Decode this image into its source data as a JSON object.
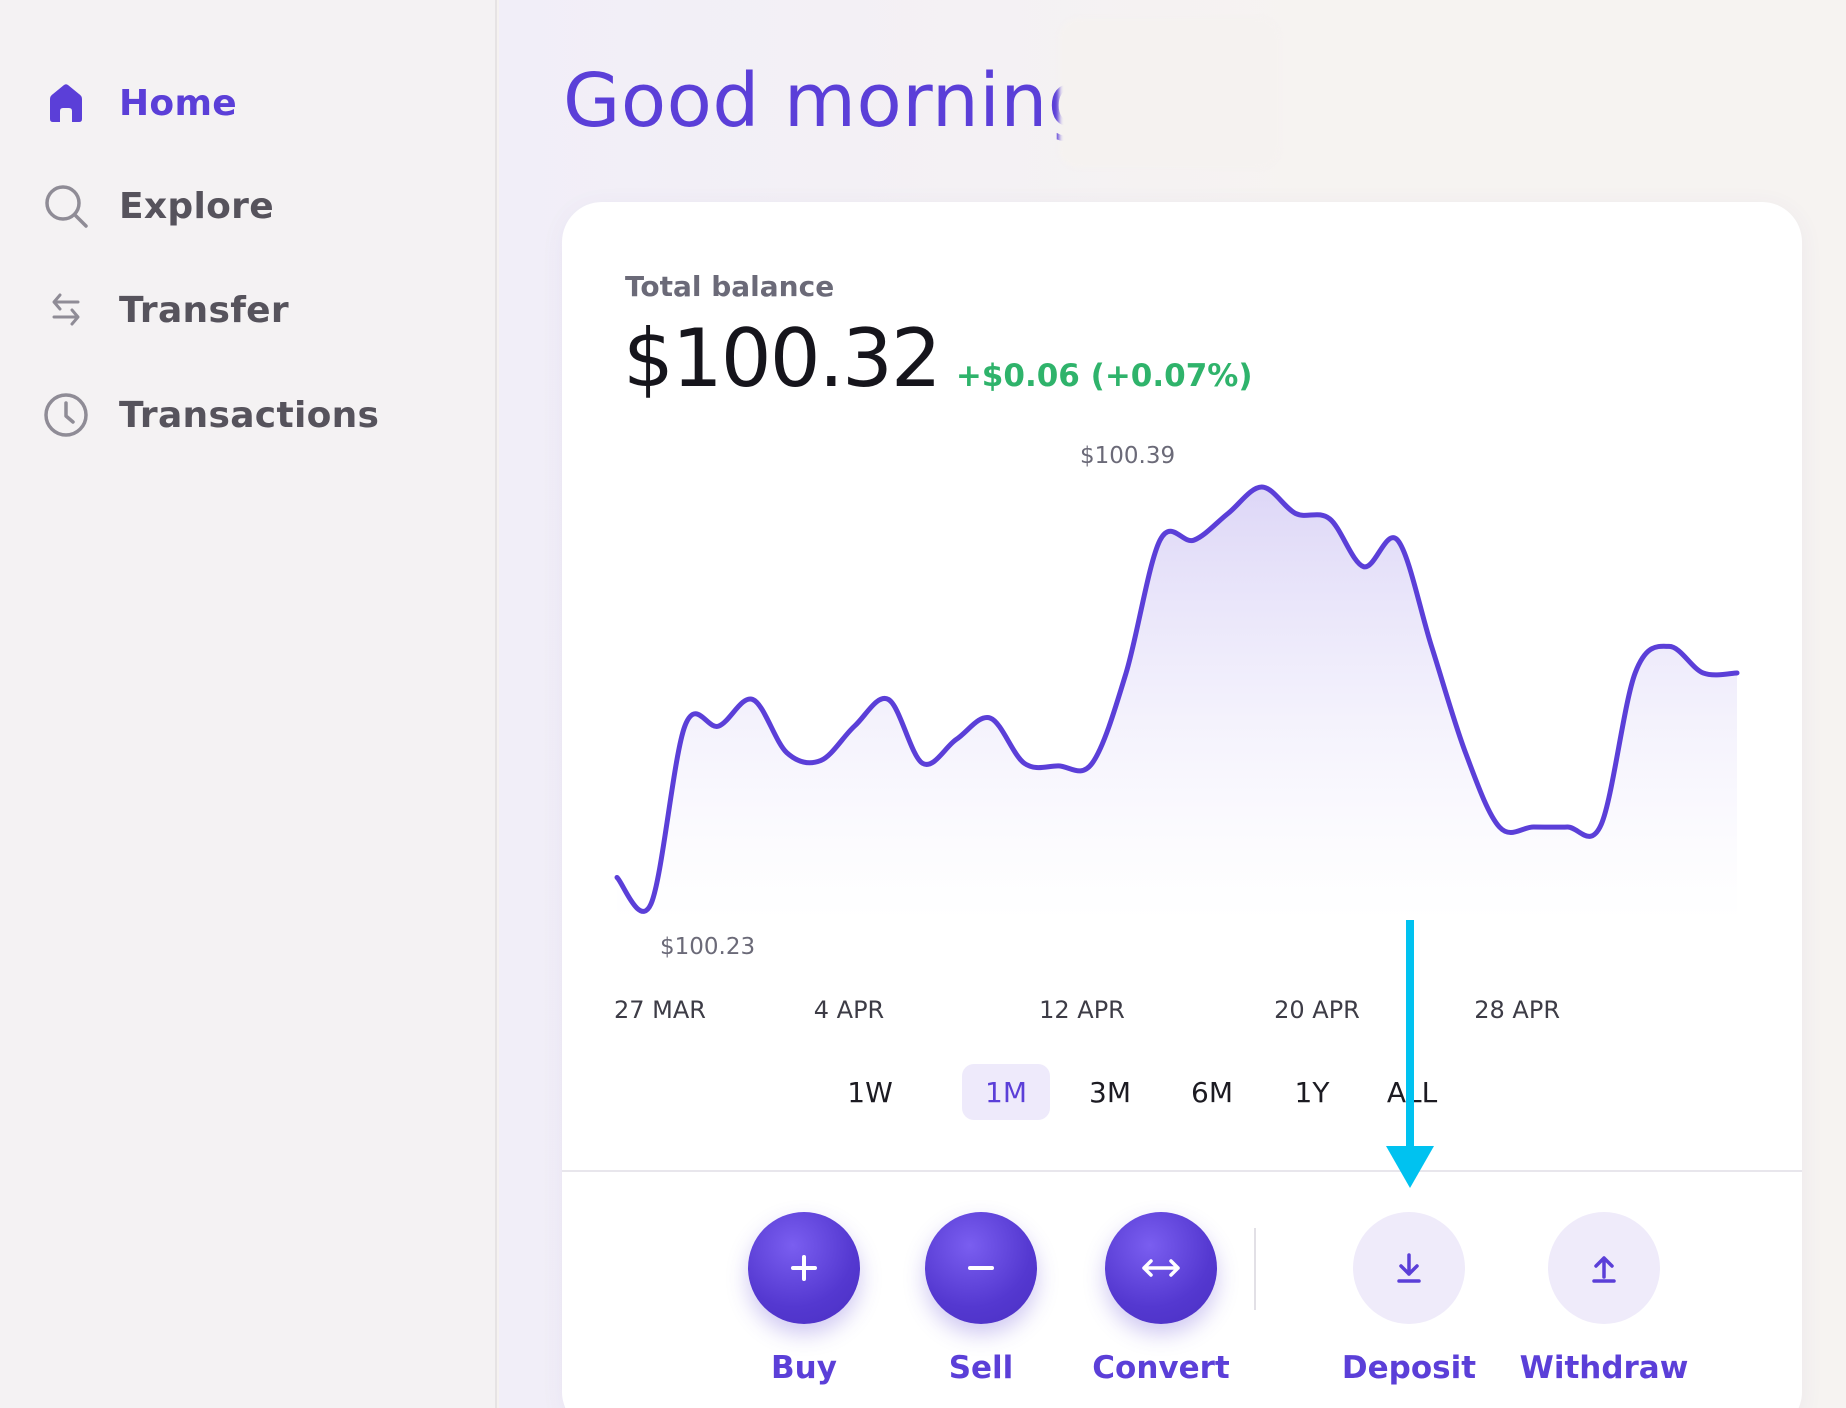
{
  "sidebar": {
    "items": [
      {
        "label": "Home",
        "icon": "home-icon",
        "active": true
      },
      {
        "label": "Explore",
        "icon": "search-icon",
        "active": false
      },
      {
        "label": "Transfer",
        "icon": "transfer-arrows-icon",
        "active": false
      },
      {
        "label": "Transactions",
        "icon": "clock-icon",
        "active": false
      }
    ]
  },
  "header": {
    "greeting": "Good morning,"
  },
  "balance": {
    "label": "Total balance",
    "value": "$100.32",
    "change": "+$0.06 (+0.07%)"
  },
  "chart_data": {
    "type": "area",
    "x_ticks": [
      "27 MAR",
      "4 APR",
      "12 APR",
      "20 APR",
      "28 APR"
    ],
    "annotations": {
      "max_label": "$100.39",
      "min_label": "$100.23"
    },
    "ylim": [
      100.23,
      100.39
    ],
    "series": [
      {
        "points": [
          [
            "27 MAR",
            100.243
          ],
          [
            "27 MAR",
            100.233
          ],
          [
            "28 MAR",
            100.3
          ],
          [
            "29 MAR",
            100.3
          ],
          [
            "30 MAR",
            100.31
          ],
          [
            "31 MAR",
            100.29
          ],
          [
            "1 APR",
            100.287
          ],
          [
            "2 APR",
            100.3
          ],
          [
            "3 APR",
            100.31
          ],
          [
            "4 APR",
            100.286
          ],
          [
            "5 APR",
            100.295
          ],
          [
            "6 APR",
            100.303
          ],
          [
            "7 APR",
            100.286
          ],
          [
            "8 APR",
            100.285
          ],
          [
            "9 APR",
            100.286
          ],
          [
            "10 APR",
            100.32
          ],
          [
            "11 APR",
            100.37
          ],
          [
            "12 APR",
            100.37
          ],
          [
            "13 APR",
            100.38
          ],
          [
            "14 APR",
            100.39
          ],
          [
            "15 APR",
            100.38
          ],
          [
            "16 APR",
            100.378
          ],
          [
            "17 APR",
            100.36
          ],
          [
            "18 APR",
            100.37
          ],
          [
            "19 APR",
            100.33
          ],
          [
            "20 APR",
            100.29
          ],
          [
            "21 APR",
            100.262
          ],
          [
            "22 APR",
            100.262
          ],
          [
            "23 APR",
            100.262
          ],
          [
            "24 APR",
            100.263
          ],
          [
            "25 APR",
            100.32
          ],
          [
            "26 APR",
            100.33
          ],
          [
            "27 APR",
            100.32
          ],
          [
            "28 APR",
            100.32
          ]
        ]
      }
    ],
    "line_color": "#5b3fd8"
  },
  "range": {
    "options": [
      "1W",
      "1M",
      "3M",
      "6M",
      "1Y",
      "ALL"
    ],
    "selected": "1M"
  },
  "actions": [
    {
      "label": "Buy",
      "icon": "plus-icon",
      "style": "primary"
    },
    {
      "label": "Sell",
      "icon": "minus-icon",
      "style": "primary"
    },
    {
      "label": "Convert",
      "icon": "convert-arrows-icon",
      "style": "primary"
    },
    {
      "label": "Deposit",
      "icon": "download-icon",
      "style": "secondary"
    },
    {
      "label": "Withdraw",
      "icon": "upload-icon",
      "style": "secondary"
    }
  ],
  "colors": {
    "accent": "#5b3fd8",
    "positive": "#2fb36b",
    "annotation_arrow": "#00c2f0"
  }
}
